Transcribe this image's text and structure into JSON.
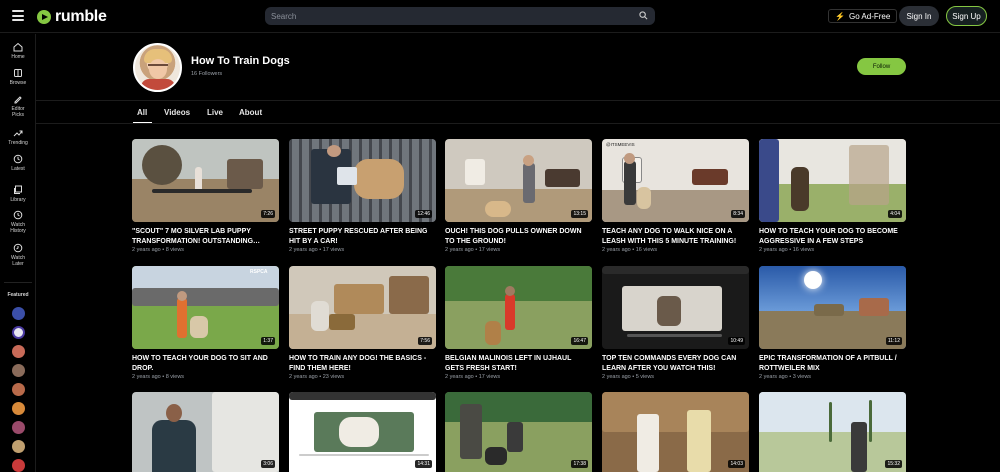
{
  "header": {
    "logo_text": "rumble",
    "search_placeholder": "Search",
    "ad_free_label": "Go Ad-Free",
    "sign_in_label": "Sign In",
    "sign_up_label": "Sign Up"
  },
  "sidebar": {
    "items": [
      {
        "label": "Home",
        "icon": "home-icon"
      },
      {
        "label": "Browse",
        "icon": "browse-icon"
      },
      {
        "label": "Editor Picks",
        "icon": "editor-picks-icon"
      },
      {
        "label": "Trending",
        "icon": "trending-icon"
      },
      {
        "label": "Latest",
        "icon": "latest-icon"
      },
      {
        "label": "Library",
        "icon": "library-icon"
      },
      {
        "label": "Watch History",
        "icon": "watch-history-icon"
      },
      {
        "label": "Watch Later",
        "icon": "watch-later-icon"
      }
    ],
    "featured_label": "Featured"
  },
  "channel": {
    "name": "How To Train Dogs",
    "followers": "16 Followers",
    "follow_label": "Follow"
  },
  "tabs": [
    {
      "label": "All",
      "active": true
    },
    {
      "label": "Videos",
      "active": false
    },
    {
      "label": "Live",
      "active": false
    },
    {
      "label": "About",
      "active": false
    }
  ],
  "videos": [
    {
      "title": "\"SCOUT\" 7 MO SILVER LAB PUPPY TRANSFORMATION! OUTSTANDING…",
      "meta": "2 years ago • 8 views",
      "duration": "7:26"
    },
    {
      "title": "STREET PUPPY RESCUED AFTER BEING HIT BY A CAR!",
      "meta": "2 years ago • 17 views",
      "duration": "12:46"
    },
    {
      "title": "OUCH! THIS DOG PULLS OWNER DOWN TO THE GROUND!",
      "meta": "2 years ago • 17 views",
      "duration": "13:15"
    },
    {
      "title": "TEACH ANY DOG TO WALK NICE ON A LEASH WITH THIS 5 MINUTE TRAINING!",
      "meta": "2 years ago • 16 views",
      "duration": "8:34"
    },
    {
      "title": "HOW TO TEACH YOUR DOG TO BECOME AGGRESSIVE IN A FEW STEPS",
      "meta": "2 years ago • 16 views",
      "duration": "4:04"
    },
    {
      "title": "HOW TO TEACH YOUR DOG TO SIT AND DROP.",
      "meta": "2 years ago • 8 views",
      "duration": "1:37"
    },
    {
      "title": "HOW TO TRAIN ANY DOG! THE BASICS - FIND THEM HERE!",
      "meta": "2 years ago • 23 views",
      "duration": "7:56"
    },
    {
      "title": "BELGIAN MALINOIS LEFT IN UJHAUL GETS FRESH START!",
      "meta": "2 years ago • 17 views",
      "duration": "16:47"
    },
    {
      "title": "TOP TEN COMMANDS EVERY DOG CAN LEARN AFTER YOU WATCH THIS!",
      "meta": "2 years ago • 5 views",
      "duration": "10:49"
    },
    {
      "title": "EPIC TRANSFORMATION OF A PITBULL / ROTTWEILER MIX",
      "meta": "2 years ago • 3 views",
      "duration": "11:12"
    },
    {
      "title": "",
      "meta": "",
      "duration": "3:06"
    },
    {
      "title": "",
      "meta": "",
      "duration": "14:31"
    },
    {
      "title": "",
      "meta": "",
      "duration": "17:38"
    },
    {
      "title": "",
      "meta": "",
      "duration": "14:03"
    },
    {
      "title": "",
      "meta": "",
      "duration": "15:32"
    }
  ],
  "thumb_overlay_text": {
    "v4": "@ITSMEEVIS",
    "v6": "RSPCA"
  },
  "colors": {
    "accent": "#85c742",
    "background": "#000000",
    "search_bg": "#252932",
    "meta_text": "#9aa0a8"
  }
}
